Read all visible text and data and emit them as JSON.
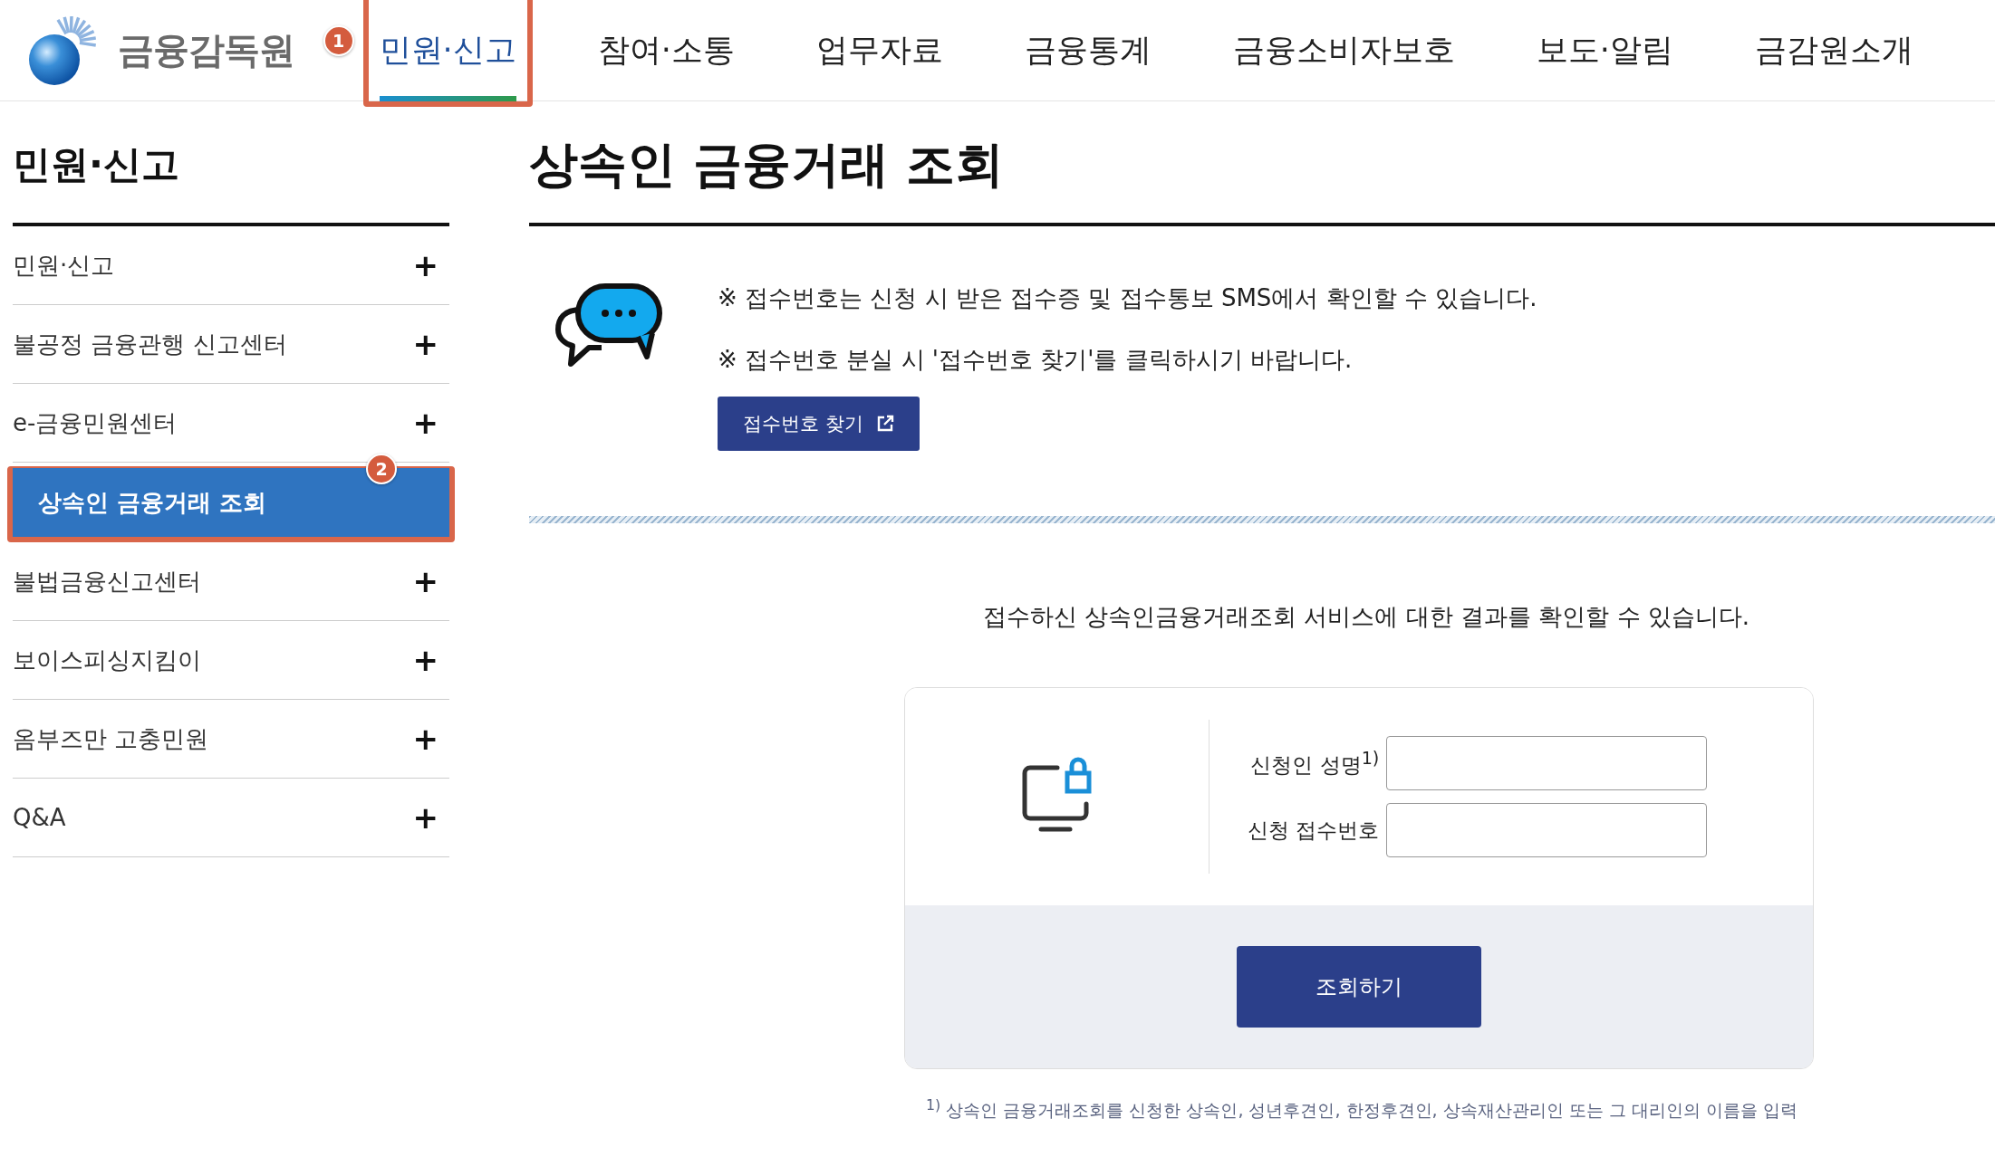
{
  "header": {
    "logo_text": "금융감독원",
    "nav": [
      {
        "label": "민원·신고",
        "selected": true,
        "callout": "1"
      },
      {
        "label": "참여·소통",
        "selected": false
      },
      {
        "label": "업무자료",
        "selected": false
      },
      {
        "label": "금융통계",
        "selected": false
      },
      {
        "label": "금융소비자보호",
        "selected": false
      },
      {
        "label": "보도·알림",
        "selected": false
      },
      {
        "label": "금감원소개",
        "selected": false
      }
    ]
  },
  "sidebar": {
    "title": "민원·신고",
    "items": [
      {
        "label": "민원·신고",
        "toggle": "+"
      },
      {
        "label": "불공정 금융관행 신고센터",
        "toggle": "+"
      },
      {
        "label": "e-금융민원센터",
        "toggle": "+",
        "children": [
          {
            "label": "상속인 금융거래 조회",
            "selected": true,
            "callout": "2"
          }
        ]
      },
      {
        "label": "불법금융신고센터",
        "toggle": "+"
      },
      {
        "label": "보이스피싱지킴이",
        "toggle": "+"
      },
      {
        "label": "옴부즈만 고충민원",
        "toggle": "+"
      },
      {
        "label": "Q&A",
        "toggle": "+"
      }
    ]
  },
  "page_title": "상속인 금융거래 조회",
  "notice": {
    "lines": [
      "※ 접수번호는 신청 시 받은 접수증 및 접수통보 SMS에서 확인할 수 있습니다.",
      "※ 접수번호 분실 시 '접수번호 찾기'를 클릭하시기 바랍니다."
    ],
    "button": "접수번호 찾기"
  },
  "intro": "접수하신 상속인금융거래조회 서비스에 대한 결과를 확인할 수 있습니다.",
  "form": {
    "fields": [
      {
        "label": "신청인 성명$^{1)}$"
      },
      {
        "label": "신청 접수번호"
      }
    ],
    "submit": "조회하기"
  },
  "footnote": "$^{1)}$ 상속인 금융거래조회를 신청한 상속인, 성년후견인, 한정후견인, 상속재산관리인 또는 그 대리인의 이름을 입력"
}
